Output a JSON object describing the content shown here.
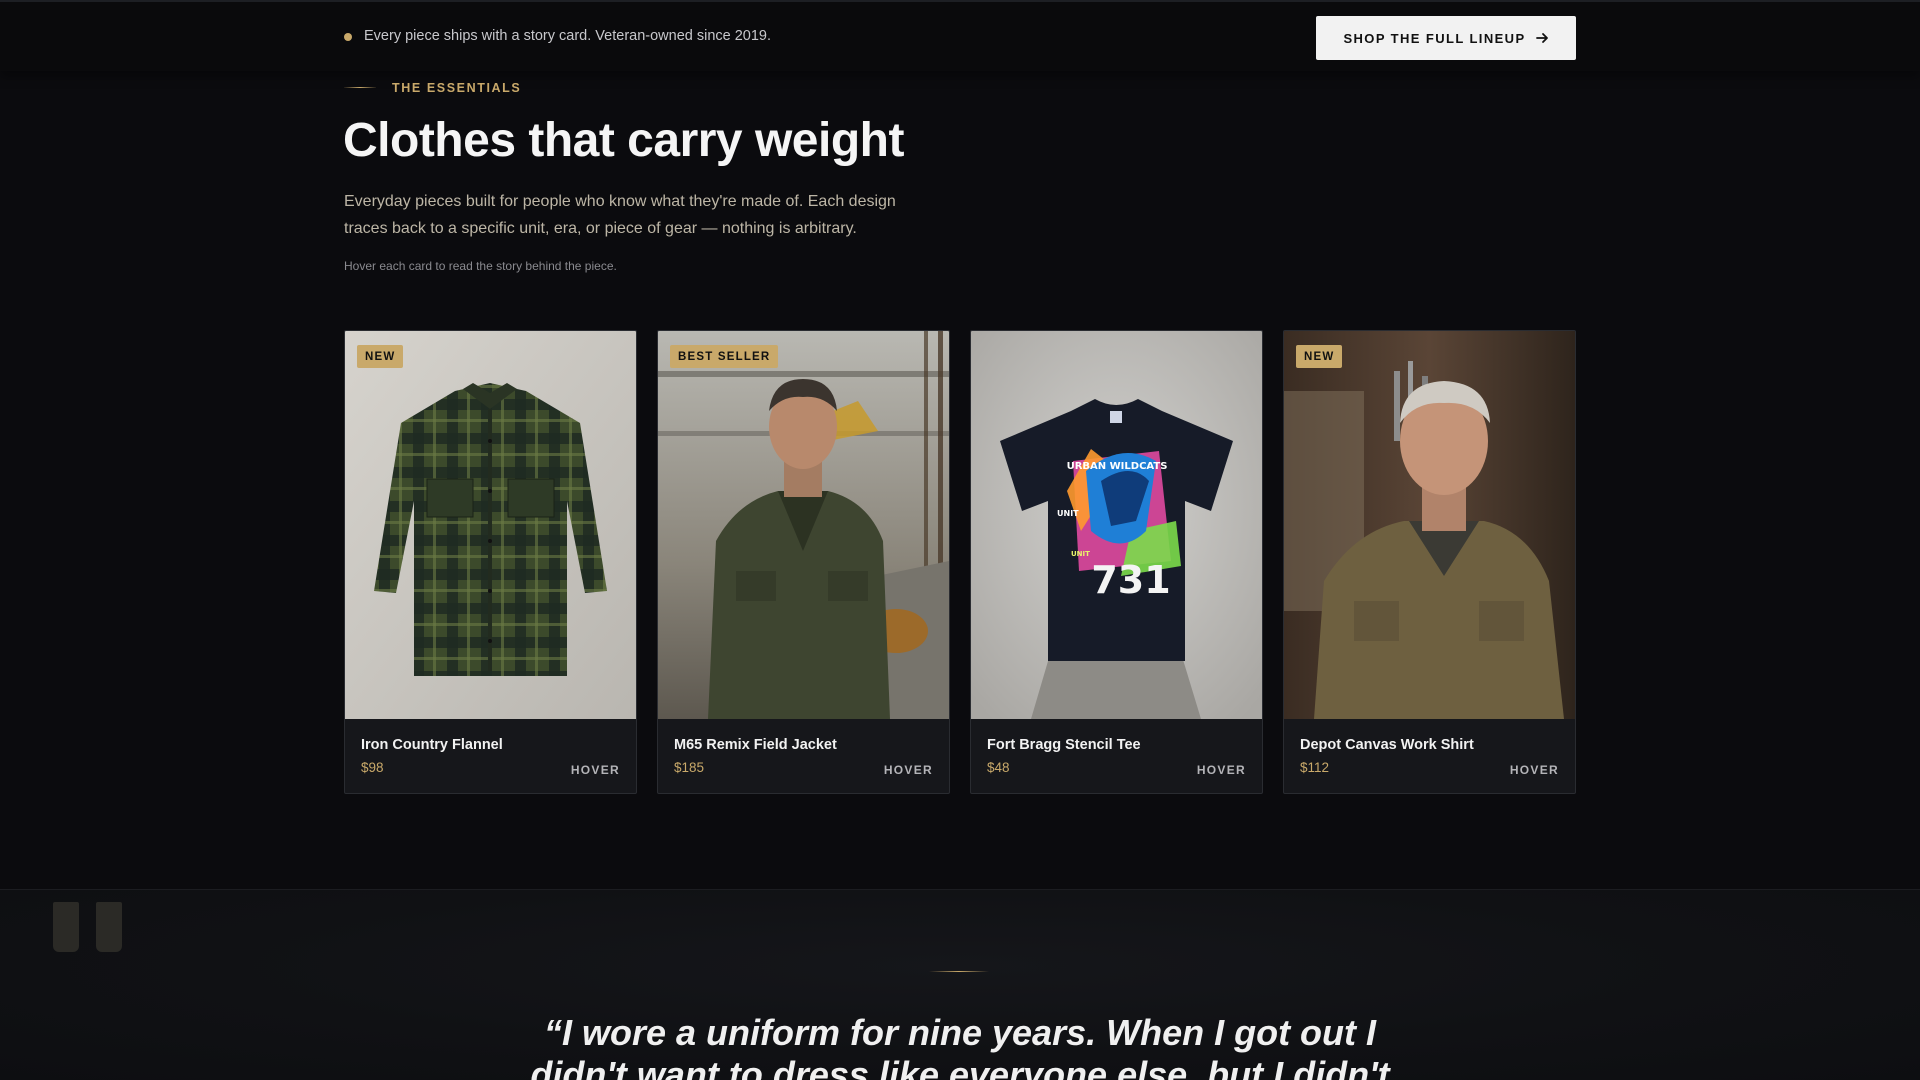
{
  "topbar": {
    "announcement": "Every piece ships with a story card. Veteran-owned since 2019.",
    "cta_label": "SHOP THE FULL LINEUP",
    "cta_icon": "arrow-right-icon"
  },
  "intro": {
    "eyebrow": "THE ESSENTIALS",
    "title": "Clothes that carry weight",
    "description": "Everyday pieces built for people who know what they're made of. Each design traces back to a specific unit, era, or piece of gear — nothing is arbitrary.",
    "hint": "Hover each card to read the story behind the piece."
  },
  "products": [
    {
      "badge": "NEW",
      "name": "Iron Country Flannel",
      "price": "$98",
      "action": "HOVER",
      "image": "olive plaid flannel shirt laid flat"
    },
    {
      "badge": "BEST SELLER",
      "name": "M65 Remix Field Jacket",
      "price": "$185",
      "action": "HOVER",
      "image": "man in olive field jacket at construction site"
    },
    {
      "badge": "",
      "name": "Fort Bragg Stencil Tee",
      "price": "$48",
      "action": "HOVER",
      "image": "black tee with colorful griffin unit graphic"
    },
    {
      "badge": "NEW",
      "name": "Depot Canvas Work Shirt",
      "price": "$112",
      "action": "HOVER",
      "image": "older man in khaki canvas work shirt in workshop"
    }
  ],
  "tee_graphic": {
    "top": "URBAN WILDCATS",
    "side_left": "UNIT",
    "side_small": "UNIT",
    "number": "731"
  },
  "testimonial": {
    "quote_line_1": "“I wore a uniform for nine years. When I got out I",
    "quote_line_2": "didn't want to dress like everyone else, but I didn't"
  },
  "colors": {
    "background": "#0b0b0e",
    "accent_gold": "#c9a96a",
    "card": "#16171b",
    "button": "#f2f2f2"
  }
}
